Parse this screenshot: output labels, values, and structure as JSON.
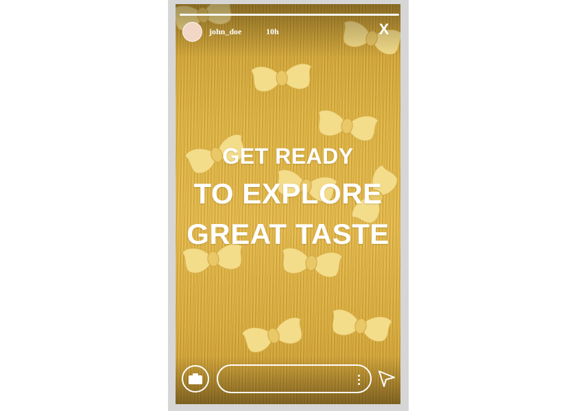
{
  "story": {
    "username": "john_doe",
    "time": "10h",
    "close_label": "X",
    "progress": 1.0
  },
  "headline": {
    "line1": "GET READY",
    "line2": "TO EXPLORE",
    "line3": "GREAT TASTE"
  },
  "footer": {
    "reply_value": "",
    "camera_icon": "camera-icon",
    "more_icon": "more-vertical-icon",
    "send_icon": "send-icon"
  },
  "colors": {
    "background": "#d9ad3c",
    "text": "#ffffff"
  }
}
